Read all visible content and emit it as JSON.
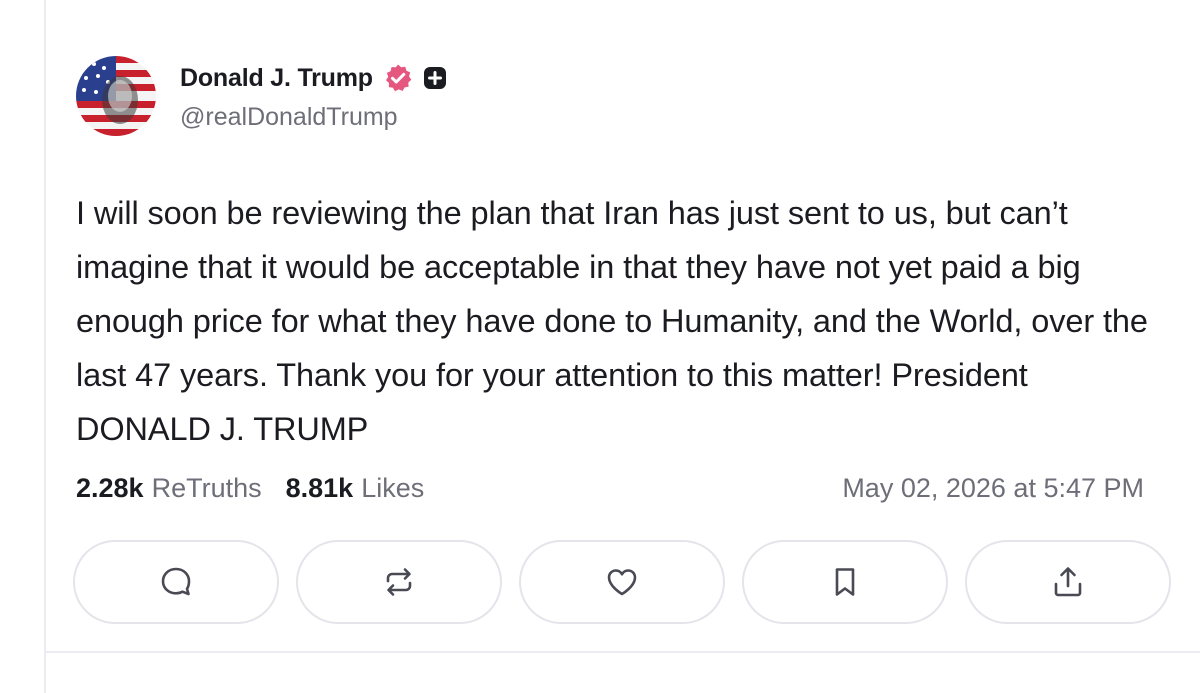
{
  "post": {
    "author_name": "Donald J. Trump",
    "handle": "@realDonaldTrump",
    "text": "I will soon be reviewing the plan that Iran has just sent to us, but can’t imagine that it would be acceptable in that they have not yet paid a big enough price for what they have done to Humanity, and the World, over the last 47 years. Thank you for your attention to this matter! President DONALD J. TRUMP",
    "retruths_count": "2.28k",
    "retruths_label": "ReTruths",
    "likes_count": "8.81k",
    "likes_label": "Likes",
    "timestamp": "May 02, 2026 at 5:47 PM"
  },
  "badges": {
    "verified_icon": "verified-badge-icon",
    "verified_color": "#e65780",
    "plus_icon": "plus-badge-icon"
  },
  "actions": [
    {
      "icon": "reply-icon"
    },
    {
      "icon": "retruth-icon"
    },
    {
      "icon": "heart-icon"
    },
    {
      "icon": "bookmark-icon"
    },
    {
      "icon": "share-icon"
    }
  ],
  "colors": {
    "text": "#1b1b22",
    "muted": "#6e6e78",
    "border": "#e4e4ea"
  }
}
